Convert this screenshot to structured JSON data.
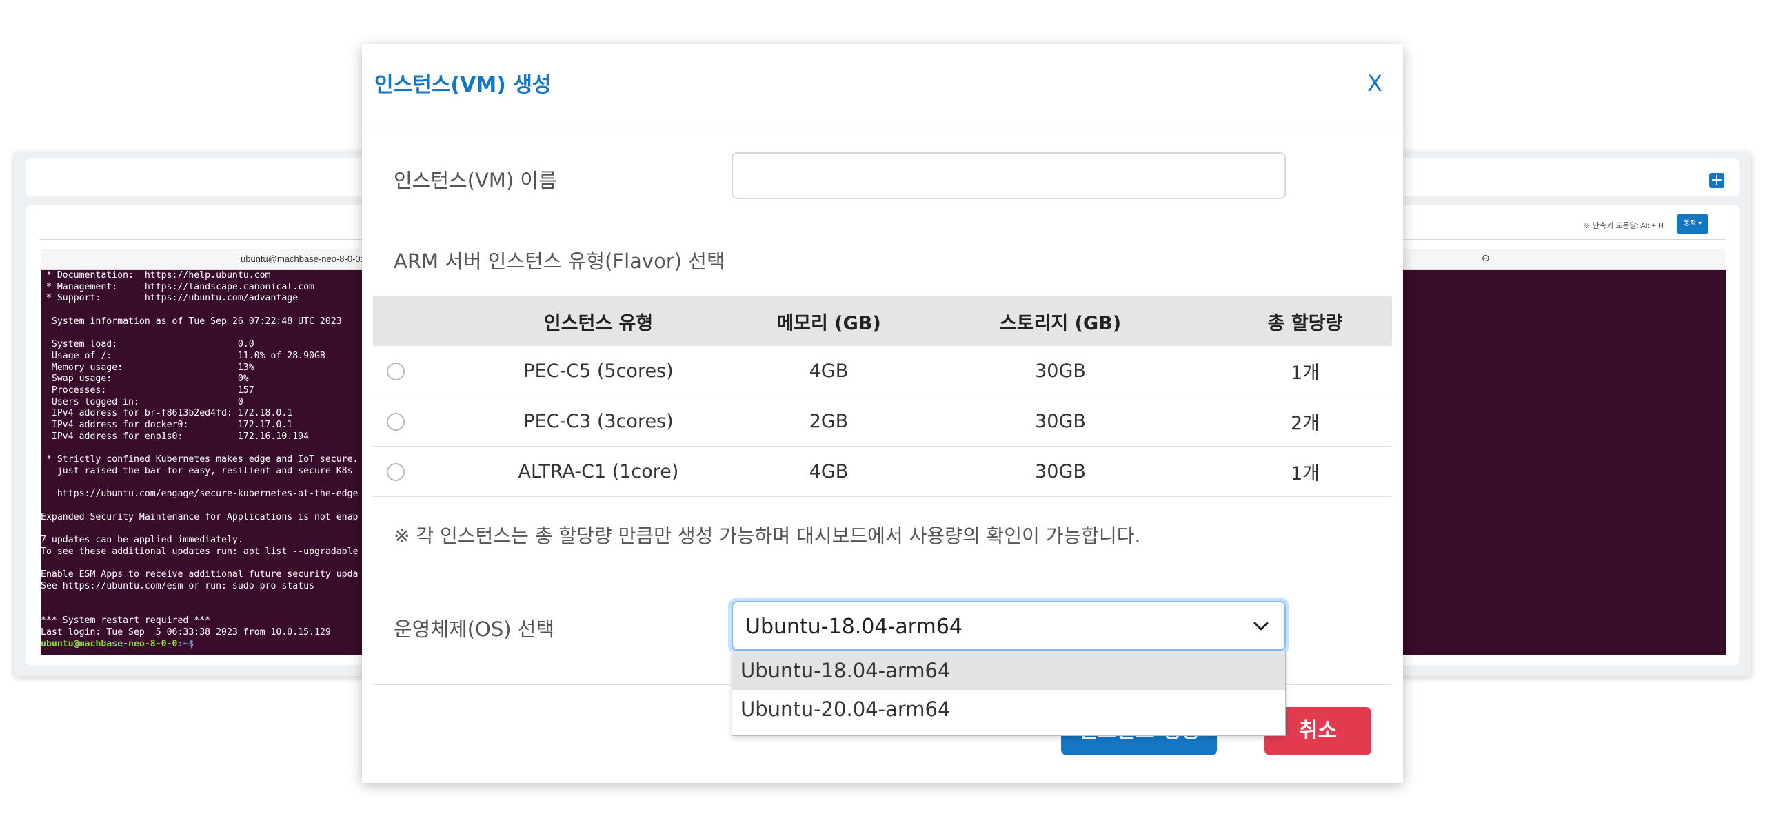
{
  "background": {
    "add_button": "+",
    "shortcut_hint": "※ 단축키 도움말: Alt + H",
    "action_button": "동작 ▾",
    "terminal_title": "ubuntu@machbase-neo-8-0-0:",
    "terminal_close": "⊝",
    "terminal_lines": [
      " * Documentation:  https://help.ubuntu.com",
      " * Management:     https://landscape.canonical.com",
      " * Support:        https://ubuntu.com/advantage",
      "",
      "  System information as of Tue Sep 26 07:22:48 UTC 2023",
      "",
      "  System load:                      0.0",
      "  Usage of /:                       11.0% of 28.90GB",
      "  Memory usage:                     13%",
      "  Swap usage:                       0%",
      "  Processes:                        157",
      "  Users logged in:                  0",
      "  IPv4 address for br-f8613b2ed4fd: 172.18.0.1",
      "  IPv4 address for docker0:         172.17.0.1",
      "  IPv4 address for enp1s0:          172.16.10.194",
      "",
      " * Strictly confined Kubernetes makes edge and IoT secure.",
      "   just raised the bar for easy, resilient and secure K8s",
      "",
      "   https://ubuntu.com/engage/secure-kubernetes-at-the-edge",
      "",
      "Expanded Security Maintenance for Applications is not enab",
      "",
      "7 updates can be applied immediately.",
      "To see these additional updates run: apt list --upgradable",
      "",
      "Enable ESM Apps to receive additional future security upda",
      "See https://ubuntu.com/esm or run: sudo pro status",
      "",
      "",
      "*** System restart required ***",
      "Last login: Tue Sep  5 06:33:38 2023 from 10.0.15.129"
    ],
    "prompt_user": "ubuntu@machbase-neo-8-0-0",
    "prompt_path": ":~$"
  },
  "modal": {
    "title": "인스턴스(VM) 생성",
    "close_label": "X",
    "name_label": "인스턴스(VM) 이름",
    "name_value": "",
    "flavor_label": "ARM 서버 인스턴스 유형(Flavor) 선택",
    "table": {
      "headers": [
        "",
        "인스턴스 유형",
        "메모리 (GB)",
        "스토리지 (GB)",
        "총 할당량"
      ],
      "rows": [
        {
          "type": "PEC-C5 (5cores)",
          "memory": "4GB",
          "storage": "30GB",
          "quota": "1개"
        },
        {
          "type": "PEC-C3 (3cores)",
          "memory": "2GB",
          "storage": "30GB",
          "quota": "2개"
        },
        {
          "type": "ALTRA-C1 (1core)",
          "memory": "4GB",
          "storage": "30GB",
          "quota": "1개"
        }
      ]
    },
    "note": "※ 각 인스턴스는 총 할당량 만큼만 생성 가능하며 대시보드에서 사용량의 확인이 가능합니다.",
    "os_label": "운영체제(OS) 선택",
    "os_selected": "Ubuntu-18.04-arm64",
    "os_options": [
      "Ubuntu-18.04-arm64",
      "Ubuntu-20.04-arm64"
    ],
    "create_button": "인스턴스 생성",
    "cancel_button": "취소"
  },
  "colors": {
    "accent": "#1576c4",
    "danger": "#e23b50",
    "terminal_bg": "#380c2a"
  }
}
